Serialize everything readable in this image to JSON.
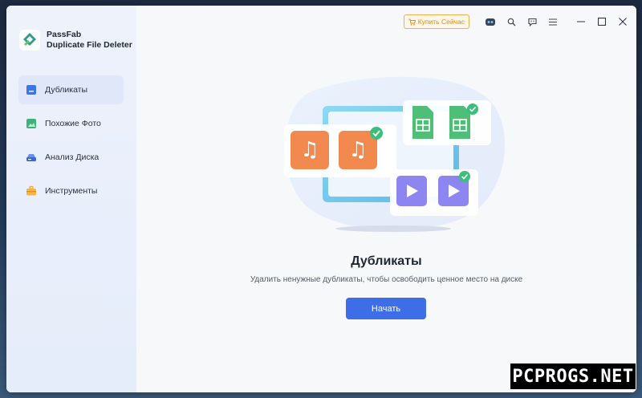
{
  "brand": {
    "line1": "PassFab",
    "line2": "Duplicate File Deleter"
  },
  "sidebar": {
    "items": [
      {
        "label": "Дубликаты",
        "icon": "file-icon",
        "active": true
      },
      {
        "label": "Похожие Фото",
        "icon": "image-icon",
        "active": false
      },
      {
        "label": "Анализ Диска",
        "icon": "disk-icon",
        "active": false
      },
      {
        "label": "Инструменты",
        "icon": "toolbox-icon",
        "active": false
      }
    ]
  },
  "titlebar": {
    "buy_label": "Купить Сейчас",
    "icons": [
      "robot-icon",
      "search-icon",
      "feedback-icon",
      "menu-icon"
    ],
    "controls": [
      "minimize-icon",
      "maximize-icon",
      "close-icon"
    ]
  },
  "main": {
    "title": "Дубликаты",
    "subtitle": "Удалить ненужные дубликаты, чтобы освободить ценное место на диске",
    "start_label": "Начать"
  },
  "watermark": "PCPROGS.NET",
  "colors": {
    "accent": "#3d6ee8",
    "buy_border": "#f0b04d",
    "music_tile": "#f28a4f",
    "sheet_tile": "#4fbf77",
    "video_tile": "#8d86f0",
    "check": "#3cbf7a"
  }
}
